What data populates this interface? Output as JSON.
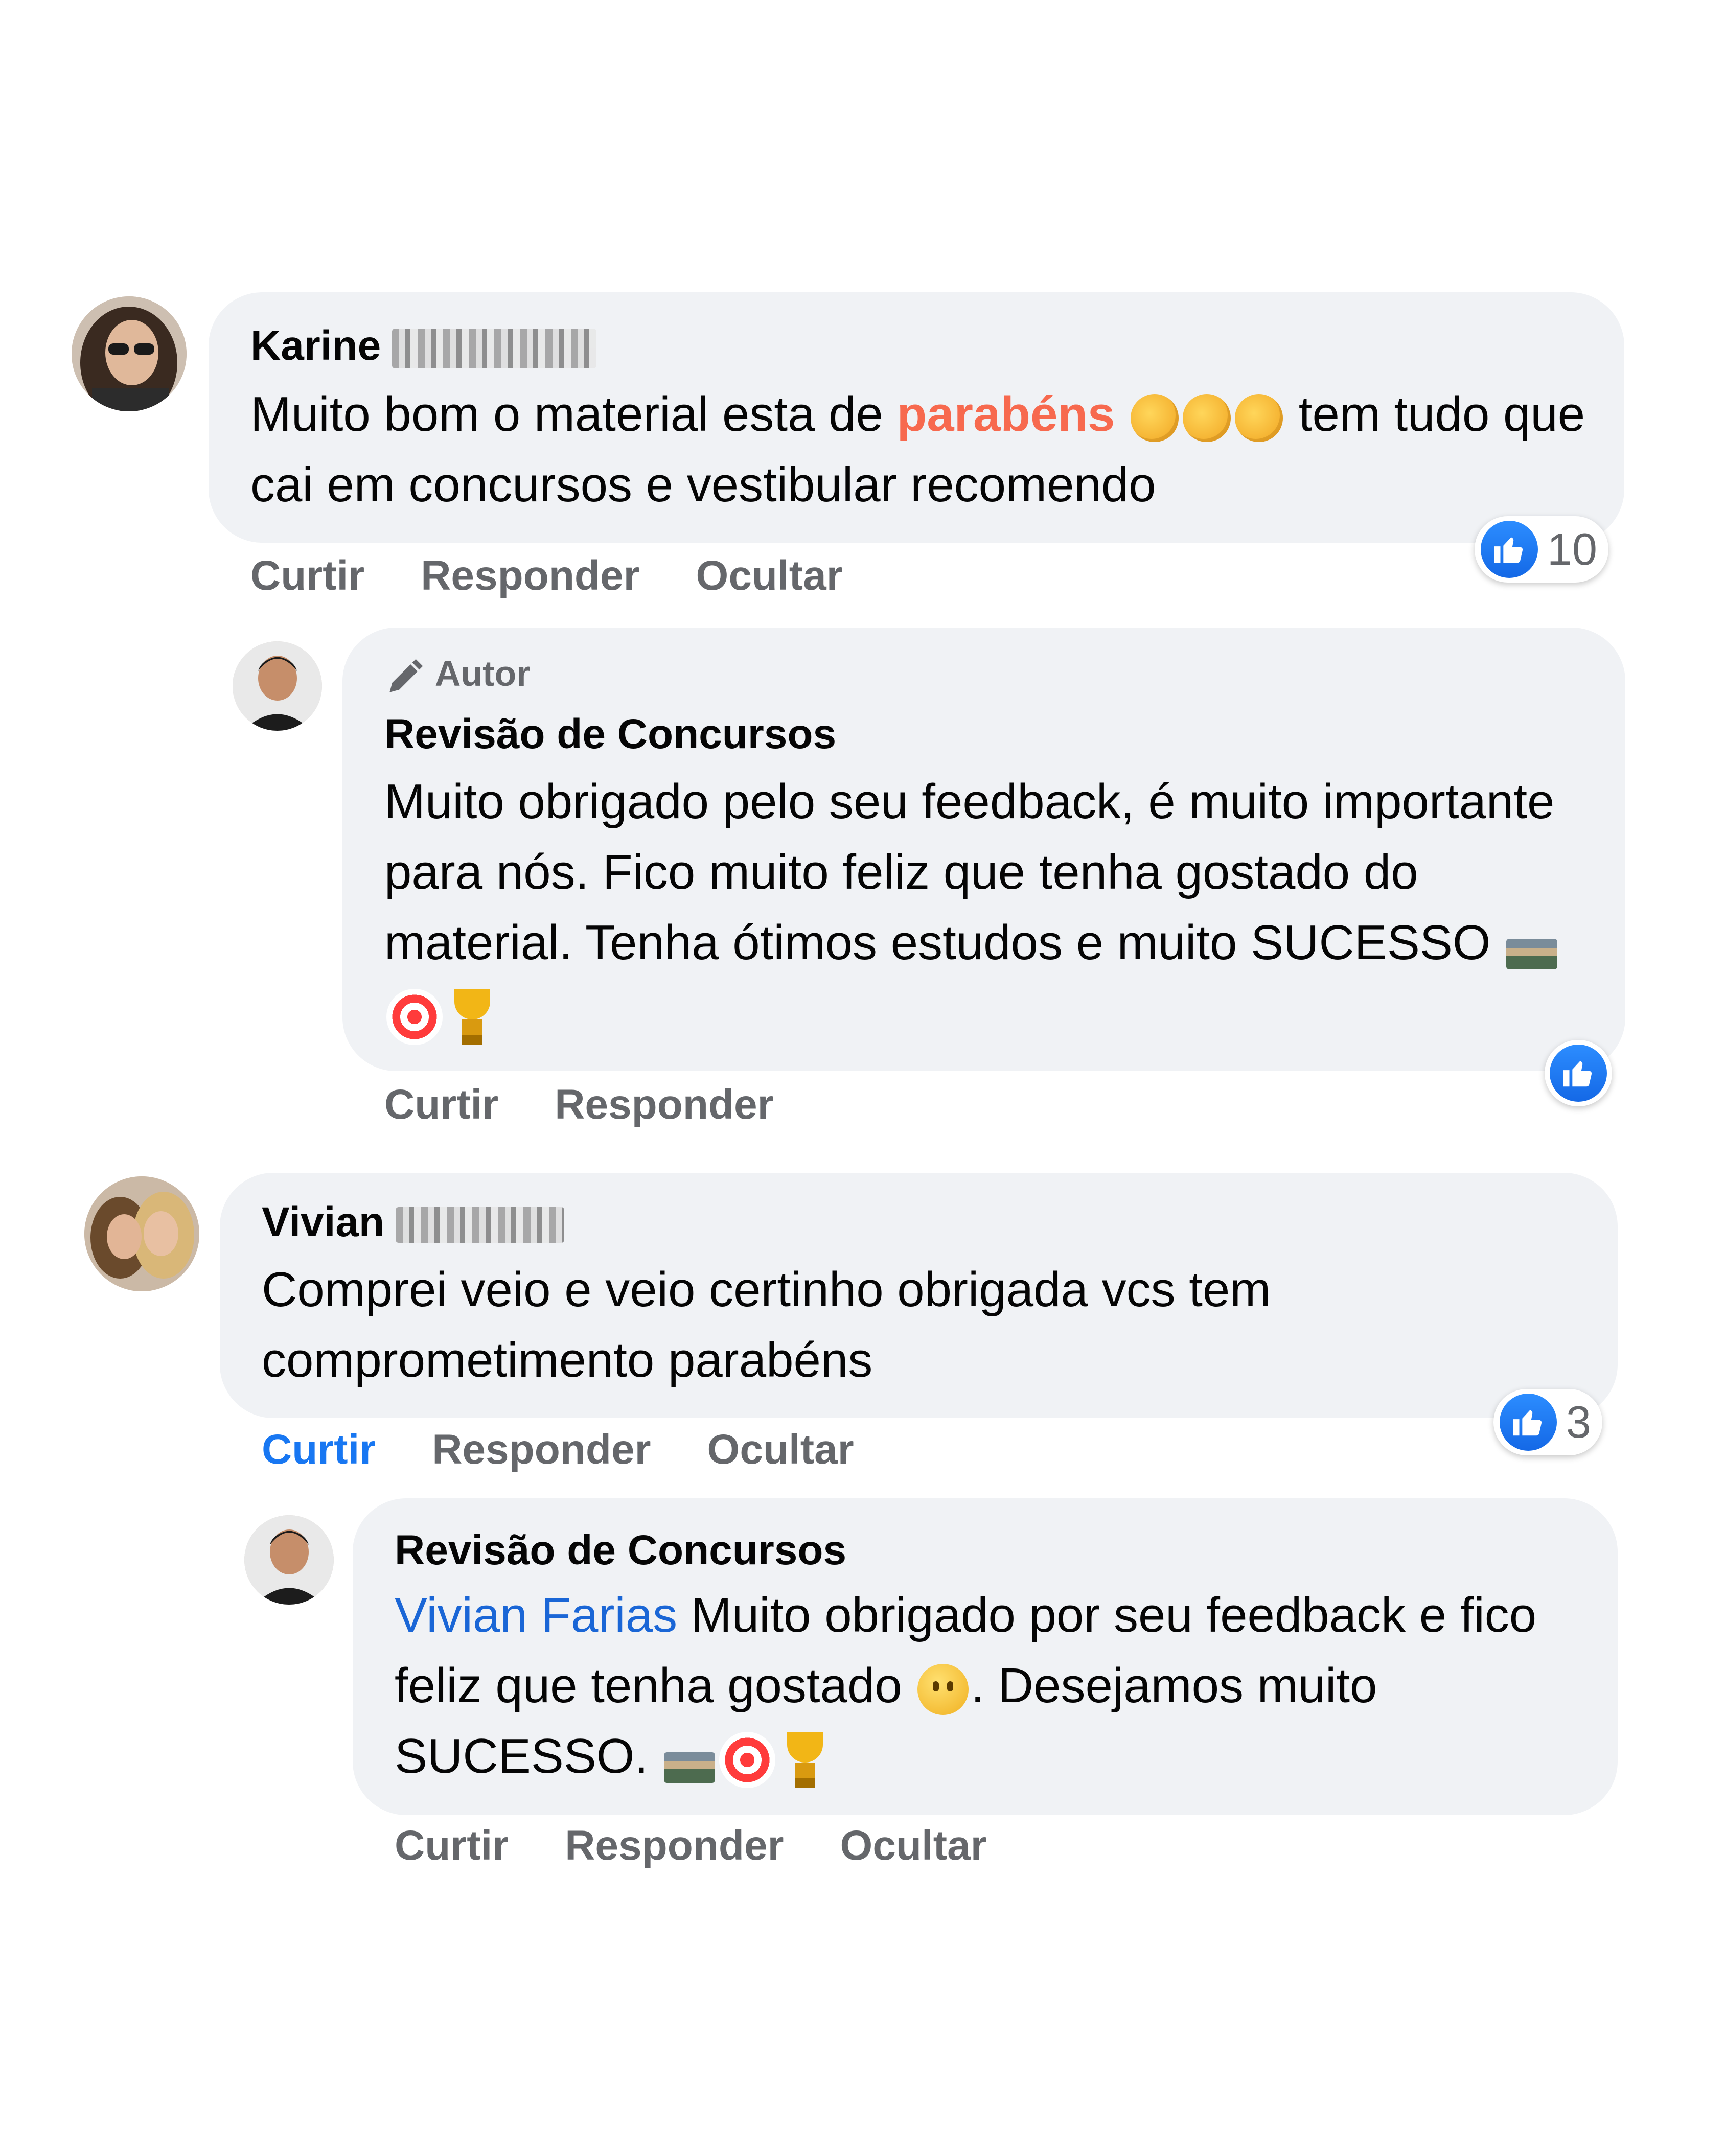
{
  "comments": [
    {
      "author": "Karine",
      "text_before": "Muito bom o material esta de ",
      "highlight": "parabéns",
      "text_after": " tem tudo que cai em concursos e vestibular recomendo",
      "actions": [
        "Curtir",
        "Responder",
        "Ocultar"
      ],
      "reaction_count": "10",
      "reply": {
        "badge": "Autor",
        "author": "Revisão de Concursos",
        "text": "Muito obrigado pelo seu feedback, é muito importante para nós. Fico muito feliz que tenha gostado do material. Tenha ótimos estudos e muito SUCESSO",
        "actions": [
          "Curtir",
          "Responder"
        ]
      }
    },
    {
      "author": "Vivian",
      "text": "Comprei veio e veio certinho obrigada vcs tem comprometimento parabéns",
      "actions": [
        "Curtir",
        "Responder",
        "Ocultar"
      ],
      "reaction_count": "3",
      "reply": {
        "author": "Revisão de Concursos",
        "mention": "Vivian Farias",
        "text_before": " Muito obrigado por seu feedback e fico feliz que tenha gostado ",
        "text_after": ". Desejamos muito SUCESSO.",
        "actions": [
          "Curtir",
          "Responder",
          "Ocultar"
        ]
      }
    }
  ],
  "colors": {
    "like_blue": "#1877f2",
    "bubble_bg": "#f0f2f5",
    "highlight": "#f7694e",
    "action_gray": "#65676b"
  },
  "icons": [
    "clapping-hands-icon",
    "books-icon",
    "direct-hit-icon",
    "trophy-icon",
    "smile-icon",
    "like-icon",
    "pencil-icon"
  ]
}
